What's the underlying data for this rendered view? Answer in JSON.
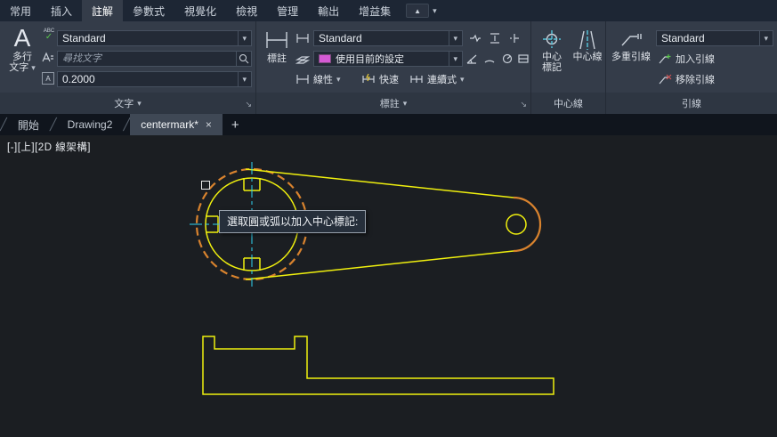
{
  "colors": {
    "c-yellow": "#f0f00e",
    "c-orange": "#d9832e",
    "c-cyan": "#2fd4f2",
    "c-magenta": "#b44fe8",
    "c-swatch": "#d45ad4"
  },
  "icons": {
    "caret": "▾",
    "close": "×",
    "plus": "+",
    "launcher": "↘",
    "slash": "╱",
    "collapse": "▲",
    "check": "✓"
  },
  "ribbon": {
    "tabs": [
      {
        "label": "常用"
      },
      {
        "label": "插入"
      },
      {
        "label": "註解"
      },
      {
        "label": "參數式"
      },
      {
        "label": "視覺化"
      },
      {
        "label": "檢視"
      },
      {
        "label": "管理"
      },
      {
        "label": "輸出"
      },
      {
        "label": "增益集"
      }
    ]
  },
  "text_panel": {
    "mtext_letter": "A",
    "mtext_label_1": "多行",
    "mtext_label_2": "文字",
    "spell_icon_text": "ABC",
    "annotative_icon_text": "A",
    "find_icon_text": "ab",
    "style_value": "Standard",
    "find_placeholder": "尋找文字",
    "height_value": "0.2000",
    "label": "文字"
  },
  "dim_panel": {
    "big_label": "標註",
    "style_value": "Standard",
    "override_value": "使用目前的設定",
    "linear": "線性",
    "quick": "快速",
    "continue": "連續式",
    "label": "標註"
  },
  "center_panel": {
    "mark_label_1": "中心",
    "mark_label_2": "標記",
    "line_label": "中心線",
    "label": "中心線"
  },
  "leader_panel": {
    "big_label": "多重引線",
    "style_value": "Standard",
    "add": "加入引線",
    "remove": "移除引線",
    "label": "引線"
  },
  "file_tabs": {
    "start": "開始",
    "drawing2": "Drawing2",
    "active": "centermark*"
  },
  "canvas": {
    "viewport_controls": "[-][上][2D 線架構]",
    "tooltip": "選取圓或弧以加入中心標記:"
  }
}
